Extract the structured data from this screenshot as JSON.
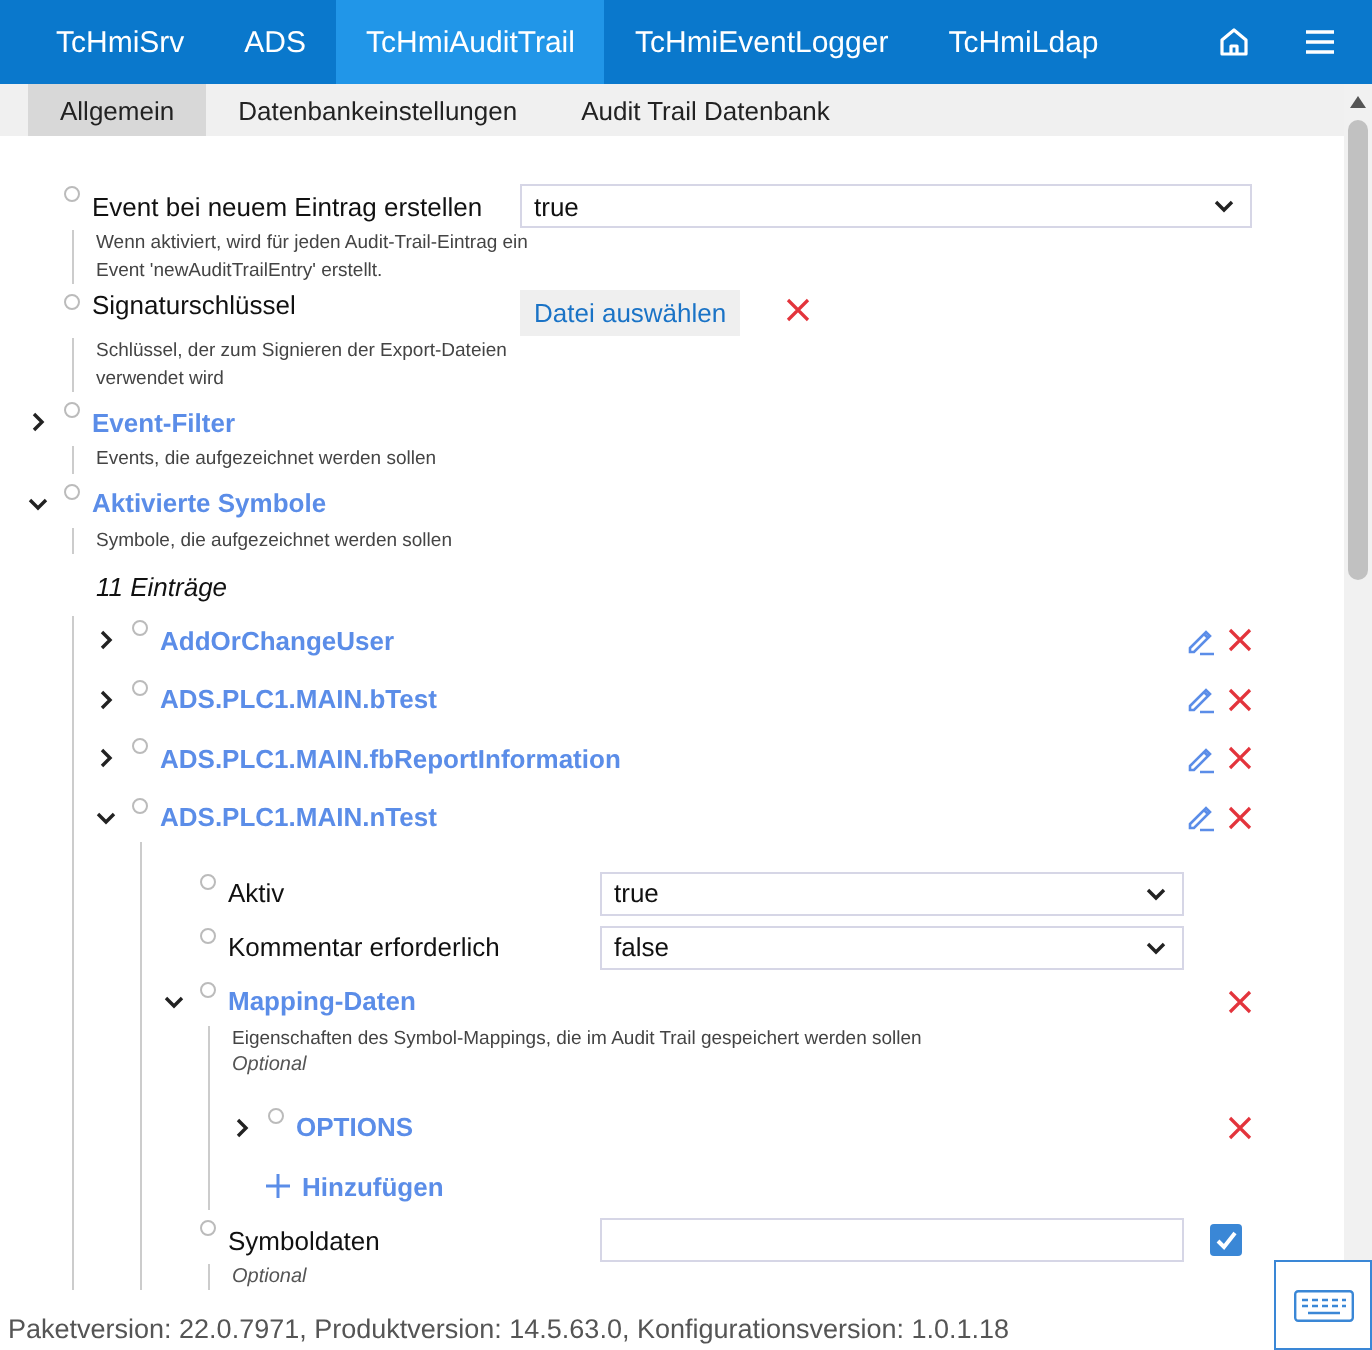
{
  "nav": {
    "tabs": [
      {
        "label": "TcHmiSrv",
        "selected": false
      },
      {
        "label": "ADS",
        "selected": false
      },
      {
        "label": "TcHmiAuditTrail",
        "selected": true
      },
      {
        "label": "TcHmiEventLogger",
        "selected": false
      },
      {
        "label": "TcHmiLdap",
        "selected": false
      }
    ]
  },
  "subtabs": [
    {
      "label": "Allgemein",
      "selected": true
    },
    {
      "label": "Datenbankeinstellungen",
      "selected": false
    },
    {
      "label": "Audit Trail Datenbank",
      "selected": false
    }
  ],
  "settings": [
    {
      "kind": "select",
      "label": "Event bei neuem Eintrag erstellen",
      "description": "Wenn aktiviert, wird für jeden Audit-Trail-Eintrag ein Event 'newAuditTrailEntry' erstellt.",
      "value": "true"
    },
    {
      "kind": "file",
      "label": "Signaturschlüssel",
      "description": "Schlüssel, der zum Signieren der Export-Dateien verwendet wird",
      "button": "Datei auswählen",
      "removable": true
    },
    {
      "kind": "group",
      "label": "Event-Filter",
      "description": "Events, die aufgezeichnet werden sollen",
      "expanded": false
    },
    {
      "kind": "group",
      "label": "Aktivierte Symbole",
      "description": "Symbole, die aufgezeichnet werden sollen",
      "expanded": true,
      "count": "11 Einträge",
      "children": [
        {
          "kind": "entry",
          "label": "AddOrChangeUser",
          "expanded": false,
          "editable": true,
          "removable": true
        },
        {
          "kind": "entry",
          "label": "ADS.PLC1.MAIN.bTest",
          "expanded": false,
          "editable": true,
          "removable": true
        },
        {
          "kind": "entry",
          "label": "ADS.PLC1.MAIN.fbReportInformation",
          "expanded": false,
          "editable": true,
          "removable": true
        },
        {
          "kind": "entry",
          "label": "ADS.PLC1.MAIN.nTest",
          "expanded": true,
          "editable": true,
          "removable": true,
          "children": [
            {
              "kind": "select",
              "label": "Aktiv",
              "value": "true"
            },
            {
              "kind": "select",
              "label": "Kommentar erforderlich",
              "value": "false"
            },
            {
              "kind": "group",
              "label": "Mapping-Daten",
              "description": "Eigenschaften des Symbol-Mappings, die im Audit Trail gespeichert werden sollen",
              "note": "Optional",
              "expanded": true,
              "removable": true,
              "add": "Hinzufügen",
              "children": [
                {
                  "kind": "entry",
                  "label": "OPTIONS",
                  "expanded": false,
                  "editable": false,
                  "removable": true
                }
              ]
            },
            {
              "kind": "text",
              "label": "Symboldaten",
              "note": "Optional",
              "checked": true
            }
          ]
        }
      ]
    }
  ],
  "footer": "Paketversion: 22.0.7971, Produktversion: 14.5.63.0, Konfigurationsversion: 1.0.1.18"
}
